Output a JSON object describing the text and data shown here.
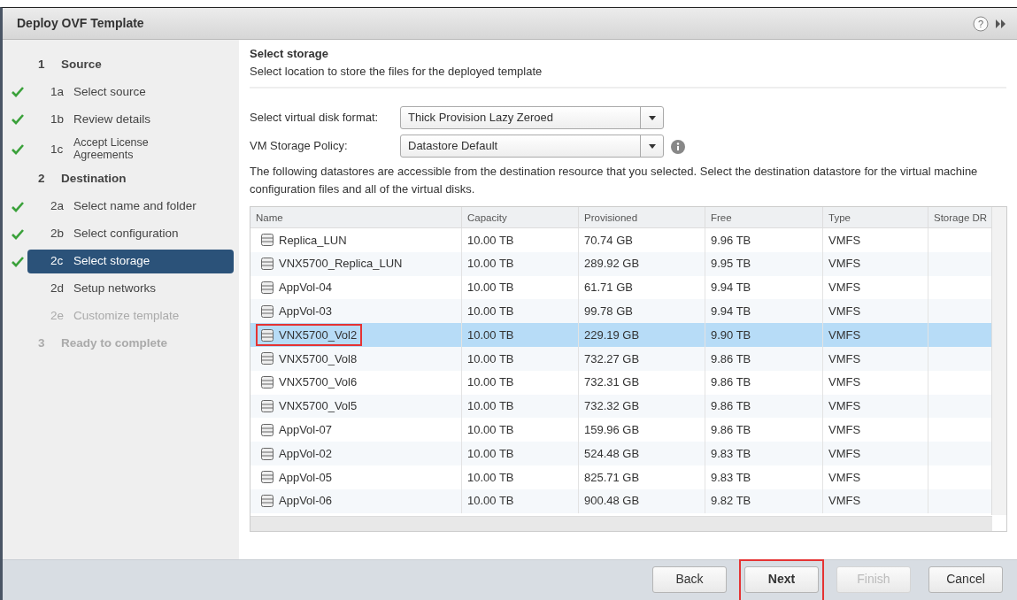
{
  "window": {
    "title": "Deploy OVF Template",
    "help": "?"
  },
  "steps": [
    {
      "number": "1",
      "label": "Source",
      "disabled": false,
      "children": [
        {
          "number": "1a",
          "label": "Select source",
          "checked": true,
          "selected": false,
          "disabled": false
        },
        {
          "number": "1b",
          "label": "Review details",
          "checked": true,
          "selected": false,
          "disabled": false
        },
        {
          "number": "1c",
          "label": "Accept License Agreements",
          "checked": true,
          "selected": false,
          "disabled": false
        }
      ]
    },
    {
      "number": "2",
      "label": "Destination",
      "disabled": false,
      "children": [
        {
          "number": "2a",
          "label": "Select name and folder",
          "checked": true,
          "selected": false,
          "disabled": false
        },
        {
          "number": "2b",
          "label": "Select configuration",
          "checked": true,
          "selected": false,
          "disabled": false
        },
        {
          "number": "2c",
          "label": "Select storage",
          "checked": true,
          "selected": true,
          "disabled": false
        },
        {
          "number": "2d",
          "label": "Setup networks",
          "checked": false,
          "selected": false,
          "disabled": false
        },
        {
          "number": "2e",
          "label": "Customize template",
          "checked": false,
          "selected": false,
          "disabled": true
        }
      ]
    },
    {
      "number": "3",
      "label": "Ready to complete",
      "disabled": true
    }
  ],
  "page": {
    "title": "Select storage",
    "subtitle": "Select location to store the files for the deployed template"
  },
  "fields": [
    {
      "label": "Select virtual disk format:",
      "value": "Thick Provision Lazy Zeroed",
      "info": false
    },
    {
      "label": "VM Storage Policy:",
      "value": "Datastore Default",
      "info": true
    }
  ],
  "description": "The following datastores are accessible from the destination resource that you selected. Select the destination datastore for the virtual machine configuration files and all of the virtual disks.",
  "table": {
    "columns": [
      "Name",
      "Capacity",
      "Provisioned",
      "Free",
      "Type",
      "Storage DR"
    ],
    "rows": [
      {
        "cells": [
          "Replica_LUN",
          "10.00 TB",
          "70.74 GB",
          "9.96 TB",
          "VMFS"
        ],
        "selected": false,
        "highlighted": false
      },
      {
        "cells": [
          "VNX5700_Replica_LUN",
          "10.00 TB",
          "289.92 GB",
          "9.95 TB",
          "VMFS"
        ],
        "selected": false,
        "highlighted": false
      },
      {
        "cells": [
          "AppVol-04",
          "10.00 TB",
          "61.71 GB",
          "9.94 TB",
          "VMFS"
        ],
        "selected": false,
        "highlighted": false
      },
      {
        "cells": [
          "AppVol-03",
          "10.00 TB",
          "99.78 GB",
          "9.94 TB",
          "VMFS"
        ],
        "selected": false,
        "highlighted": false
      },
      {
        "cells": [
          "VNX5700_Vol2",
          "10.00 TB",
          "229.19 GB",
          "9.90 TB",
          "VMFS"
        ],
        "selected": true,
        "highlighted": true
      },
      {
        "cells": [
          "VNX5700_Vol8",
          "10.00 TB",
          "732.27 GB",
          "9.86 TB",
          "VMFS"
        ],
        "selected": false,
        "highlighted": false
      },
      {
        "cells": [
          "VNX5700_Vol6",
          "10.00 TB",
          "732.31 GB",
          "9.86 TB",
          "VMFS"
        ],
        "selected": false,
        "highlighted": false
      },
      {
        "cells": [
          "VNX5700_Vol5",
          "10.00 TB",
          "732.32 GB",
          "9.86 TB",
          "VMFS"
        ],
        "selected": false,
        "highlighted": false
      },
      {
        "cells": [
          "AppVol-07",
          "10.00 TB",
          "159.96 GB",
          "9.86 TB",
          "VMFS"
        ],
        "selected": false,
        "highlighted": false
      },
      {
        "cells": [
          "AppVol-02",
          "10.00 TB",
          "524.48 GB",
          "9.83 TB",
          "VMFS"
        ],
        "selected": false,
        "highlighted": false
      },
      {
        "cells": [
          "AppVol-05",
          "10.00 TB",
          "825.71 GB",
          "9.83 TB",
          "VMFS"
        ],
        "selected": false,
        "highlighted": false
      },
      {
        "cells": [
          "AppVol-06",
          "10.00 TB",
          "900.48 GB",
          "9.82 TB",
          "VMFS"
        ],
        "selected": false,
        "highlighted": false
      }
    ]
  },
  "buttons": [
    {
      "label": "Back",
      "disabled": false,
      "primary": false,
      "highlighted": false
    },
    {
      "label": "Next",
      "disabled": false,
      "primary": true,
      "highlighted": true
    },
    {
      "label": "Finish",
      "disabled": true,
      "primary": false,
      "highlighted": false
    },
    {
      "label": "Cancel",
      "disabled": false,
      "primary": false,
      "highlighted": false
    }
  ]
}
